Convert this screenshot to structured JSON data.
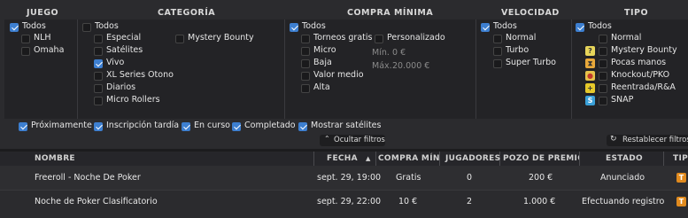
{
  "headers": {
    "juego": "JUEGO",
    "categoria": "CATEGORÍA",
    "compra": "COMPRA MÍNIMA",
    "velocidad": "VELOCIDAD",
    "tipo": "TIPO"
  },
  "juego": [
    {
      "label": "Todos",
      "checked": true
    },
    {
      "label": "NLH",
      "checked": false
    },
    {
      "label": "Omaha",
      "checked": false
    }
  ],
  "categoria": {
    "todos": {
      "label": "Todos",
      "checked": false
    },
    "left": [
      {
        "label": "Especial",
        "checked": false
      },
      {
        "label": "Satélites",
        "checked": false
      },
      {
        "label": "Vivo",
        "checked": true
      },
      {
        "label": "XL Series Otono",
        "checked": false
      },
      {
        "label": "Diarios",
        "checked": false
      },
      {
        "label": "Micro Rollers",
        "checked": false
      }
    ],
    "right": [
      {
        "label": "Mystery Bounty",
        "checked": false
      }
    ]
  },
  "compra": {
    "todos": {
      "label": "Todos",
      "checked": true
    },
    "left": [
      {
        "label": "Torneos gratis",
        "checked": false
      },
      {
        "label": "Micro",
        "checked": false
      },
      {
        "label": "Baja",
        "checked": false
      },
      {
        "label": "Valor medio",
        "checked": false
      },
      {
        "label": "Alta",
        "checked": false
      }
    ],
    "personalizado": {
      "label": "Personalizado",
      "checked": false
    },
    "min_label": "Mín.",
    "min_placeholder": "0 €",
    "max_label": "Máx.",
    "max_placeholder": "20.000 €"
  },
  "velocidad": [
    {
      "label": "Todos",
      "checked": true
    },
    {
      "label": "Normal",
      "checked": false
    },
    {
      "label": "Turbo",
      "checked": false
    },
    {
      "label": "Super Turbo",
      "checked": false
    }
  ],
  "tipo": [
    {
      "label": "Todos",
      "checked": true
    },
    {
      "label": "Normal",
      "checked": false
    },
    {
      "label": "Mystery Bounty",
      "checked": false
    },
    {
      "label": "Pocas manos",
      "checked": false
    },
    {
      "label": "Knockout/PKO",
      "checked": false
    },
    {
      "label": "Reentrada/R&A",
      "checked": false
    },
    {
      "label": "SNAP",
      "checked": false
    }
  ],
  "estado_filters": [
    {
      "label": "Próximamente",
      "checked": true
    },
    {
      "label": "Inscripción tardía",
      "checked": true
    },
    {
      "label": "En curso",
      "checked": true
    },
    {
      "label": "Completado",
      "checked": true
    },
    {
      "label": "Mostrar satélites",
      "checked": true
    }
  ],
  "hide_filters": "Ocultar filtros",
  "reset_filters": "Restablecer filtros",
  "table": {
    "columns": [
      "NOMBRE",
      "FECHA",
      "COMPRA MÍNI...",
      "JUGADORES",
      "POZO DE PREMIOS",
      "ESTADO",
      "TIP"
    ],
    "rows": [
      {
        "nombre": "Freeroll - Noche De Poker",
        "fecha": "sept. 29, 19:00",
        "compra": "Gratis",
        "jugadores": "0",
        "pozo": "200 €",
        "estado": "Anunciado",
        "tipo": "T"
      },
      {
        "nombre": "Noche de Poker Clasificatorio",
        "fecha": "sept. 29, 22:00",
        "compra": "10 €",
        "jugadores": "2",
        "pozo": "1.000 €",
        "estado": "Efectuando registro",
        "tipo": "T"
      }
    ]
  },
  "colors": {
    "accent": "#3d7fd0",
    "orange": "#e08a1e"
  }
}
